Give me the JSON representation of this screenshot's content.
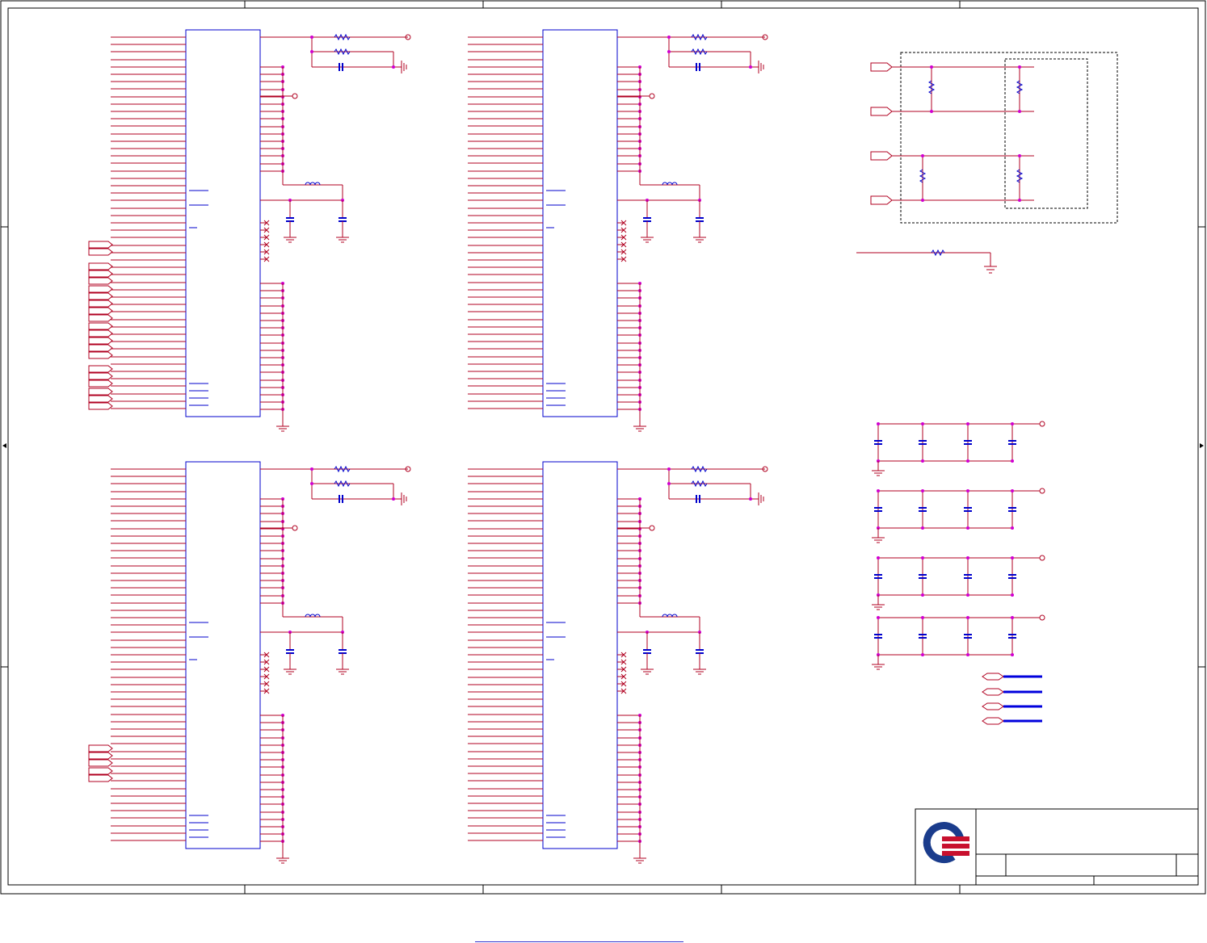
{
  "schematic": {
    "colors": {
      "net": "#b00020",
      "part": "#0000cc",
      "junction": "#d000d0",
      "frame": "#000000",
      "bus": "#0000dd"
    },
    "chips": [
      {
        "name": "u-top-left"
      },
      {
        "name": "u-top-right"
      },
      {
        "name": "u-bottom-left"
      },
      {
        "name": "u-bottom-right"
      }
    ],
    "title_block": {
      "logo": "quanta-logo"
    }
  }
}
